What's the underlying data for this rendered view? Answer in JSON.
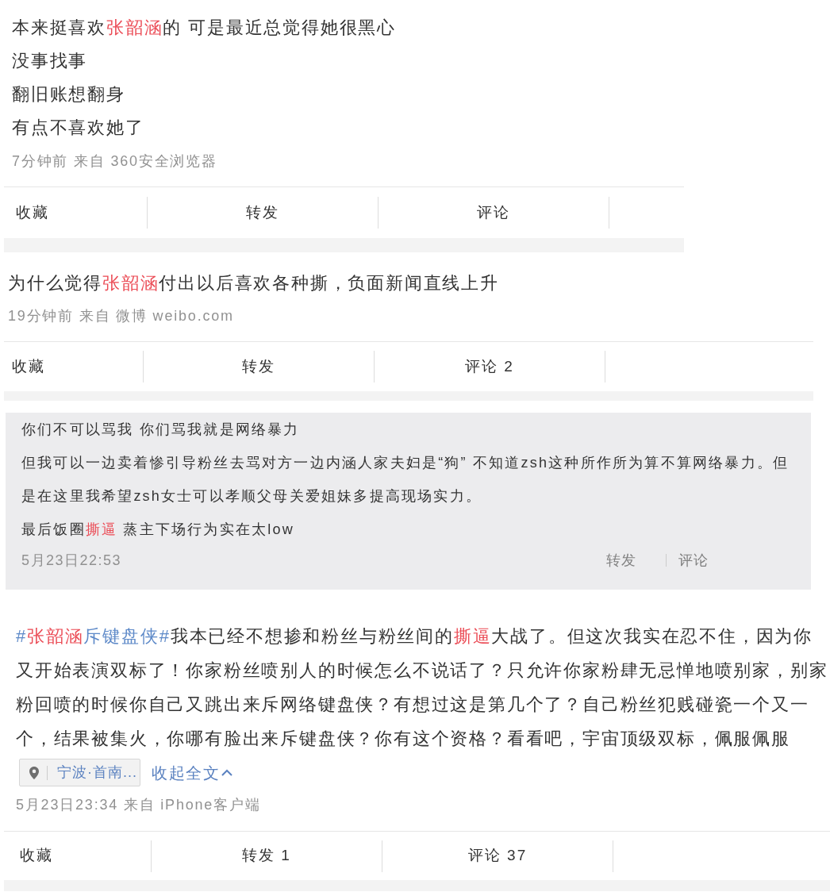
{
  "posts": [
    {
      "kind": "feed",
      "paragraphs": [
        {
          "segments": [
            {
              "text": "本来挺喜欢",
              "kind": "plain"
            },
            {
              "text": "张韶涵",
              "kind": "keyword"
            },
            {
              "text": "的 可是最近总觉得她很黑心",
              "kind": "plain"
            }
          ]
        },
        {
          "segments": [
            {
              "text": "没事找事",
              "kind": "plain"
            }
          ]
        },
        {
          "segments": [
            {
              "text": "翻旧账想翻身",
              "kind": "plain"
            }
          ]
        },
        {
          "segments": [
            {
              "text": "有点不喜欢她了",
              "kind": "plain"
            }
          ]
        }
      ],
      "meta": "7分钟前 来自 360安全浏览器",
      "actions": [
        {
          "kind": "favorite",
          "label": "收藏"
        },
        {
          "kind": "repost",
          "label": "转发"
        },
        {
          "kind": "comment",
          "label": "评论"
        }
      ]
    },
    {
      "kind": "feed",
      "paragraphs": [
        {
          "segments": [
            {
              "text": "为什么觉得",
              "kind": "plain"
            },
            {
              "text": "张韶涵",
              "kind": "keyword"
            },
            {
              "text": "付出以后喜欢各种撕，负面新闻直线上升",
              "kind": "plain"
            }
          ]
        }
      ],
      "meta": "19分钟前 来自 微博 weibo.com",
      "actions": [
        {
          "kind": "favorite",
          "label": "收藏"
        },
        {
          "kind": "repost",
          "label": "转发"
        },
        {
          "kind": "comment",
          "label": "评论 2"
        }
      ]
    },
    {
      "kind": "quote",
      "paragraphs": [
        {
          "segments": [
            {
              "text": "你们不可以骂我 你们骂我就是网络暴力",
              "kind": "plain"
            }
          ]
        },
        {
          "segments": [
            {
              "text": "但我可以一边卖着惨引导粉丝去骂对方一边内涵人家夫妇是“狗” 不知道zsh这种所作所为算不算网络暴力。但是在这里我希望zsh女士可以孝顺父母关爱姐妹多提高现场实力。",
              "kind": "plain"
            }
          ]
        },
        {
          "segments": [
            {
              "text": "最后饭圈",
              "kind": "plain"
            },
            {
              "text": "撕逼",
              "kind": "keyword"
            },
            {
              "text": " 蒸主下场行为实在太low",
              "kind": "plain"
            }
          ]
        }
      ],
      "meta": "5月23日22:53",
      "actions": [
        {
          "kind": "repost",
          "label": "转发"
        },
        {
          "kind": "comment",
          "label": "评论"
        }
      ]
    },
    {
      "kind": "feed",
      "paragraphs": [
        {
          "hashtag": [
            {
              "text": "#",
              "kind": "topic"
            },
            {
              "text": "张韶涵",
              "kind": "keyword"
            },
            {
              "text": "斥键盘侠#",
              "kind": "topic"
            }
          ],
          "segments": [
            {
              "text": "我本已经不想掺和粉丝与粉丝间的",
              "kind": "plain"
            },
            {
              "text": "撕逼",
              "kind": "keyword"
            },
            {
              "text": "大战了。但这次我实在忍不住，因为你又开始表演双标了！你家粉丝喷别人的时候怎么不说话了？只允许你家粉肆无忌惮地喷别家，别家粉回喷的时候你自己又跳出来斥网络键盘侠？有想过这是第几个了？自己粉丝犯贱碰瓷一个又一个，结果被集火，你哪有脸出来斥键盘侠？你有这个资格？看看吧，宇宙顶级双标，佩服佩服",
              "kind": "plain"
            }
          ]
        }
      ],
      "location": "宁波·首南...",
      "collapse_link": "收起全文",
      "meta": "5月23日23:34 来自 iPhone客户端",
      "actions": [
        {
          "kind": "favorite",
          "label": "收藏"
        },
        {
          "kind": "repost",
          "label": "转发 1"
        },
        {
          "kind": "comment",
          "label": "评论 37"
        }
      ]
    }
  ]
}
